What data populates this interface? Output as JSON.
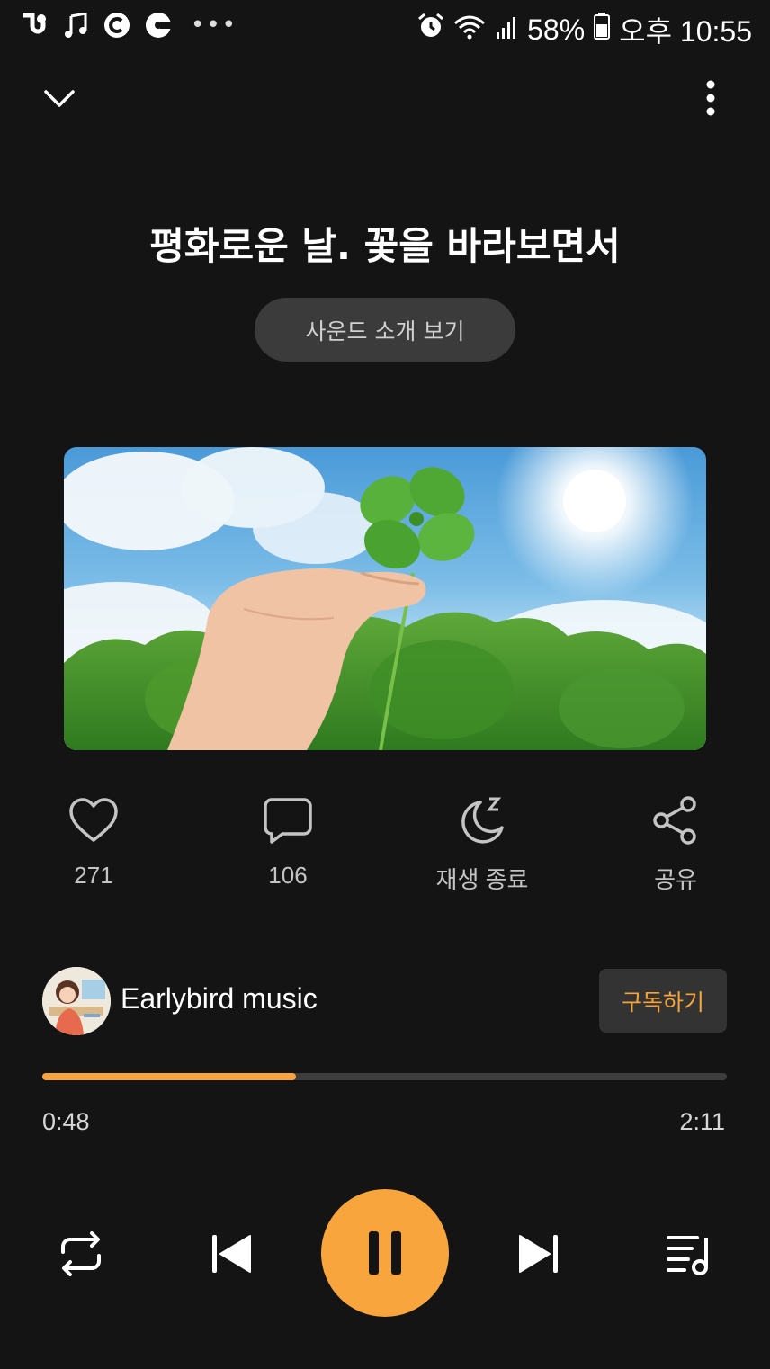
{
  "status_bar": {
    "battery": "58%",
    "time": "오후 10:55"
  },
  "header": {
    "title": "평화로운 날. 꽃을 바라보면서",
    "intro_button": "사운드 소개 보기"
  },
  "actions": {
    "like_count": "271",
    "comment_count": "106",
    "sleep_timer_label": "재생 종료",
    "share_label": "공유"
  },
  "channel": {
    "name": "Earlybird music",
    "subscribe_label": "구독하기"
  },
  "player": {
    "elapsed": "0:48",
    "duration": "2:11",
    "progress": 0.37,
    "state": "playing"
  },
  "colors": {
    "accent": "#f7a53c",
    "background": "#141414"
  }
}
